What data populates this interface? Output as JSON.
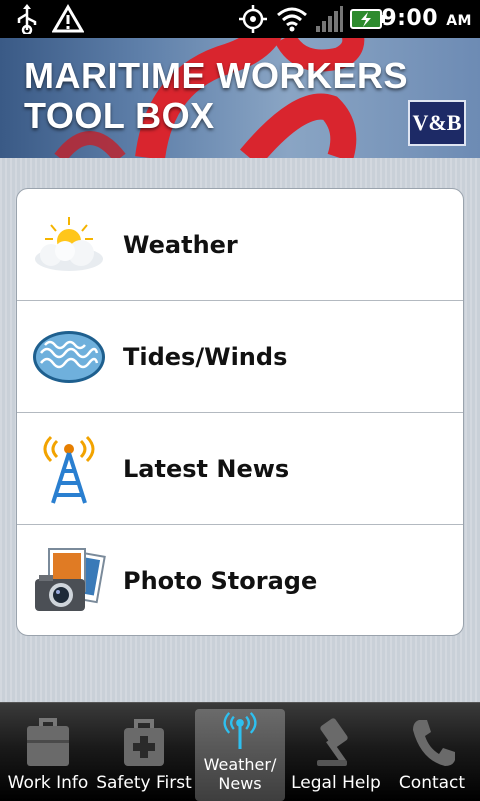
{
  "status_bar": {
    "time": "9:00",
    "ampm": "AM",
    "icons": [
      "usb-icon",
      "warning-icon",
      "gps-icon",
      "wifi-icon",
      "signal-icon",
      "battery-charging-icon"
    ]
  },
  "header": {
    "title_line1": "MARITIME WORKERS",
    "title_line2": "TOOL BOX",
    "logo_text": "V&B"
  },
  "menu": {
    "items": [
      {
        "label": "Weather",
        "icon": "weather-icon"
      },
      {
        "label": "Tides/Winds",
        "icon": "tides-winds-icon"
      },
      {
        "label": "Latest News",
        "icon": "news-tower-icon"
      },
      {
        "label": "Photo Storage",
        "icon": "photo-camera-icon"
      }
    ]
  },
  "tabs": {
    "items": [
      {
        "label": "Work Info",
        "icon": "briefcase-icon"
      },
      {
        "label": "Safety First",
        "icon": "first-aid-kit-icon"
      },
      {
        "label": "Weather/ News",
        "icon": "broadcast-tower-icon",
        "selected": true
      },
      {
        "label": "Legal Help",
        "icon": "gavel-icon"
      },
      {
        "label": "Contact",
        "icon": "phone-icon"
      }
    ]
  }
}
